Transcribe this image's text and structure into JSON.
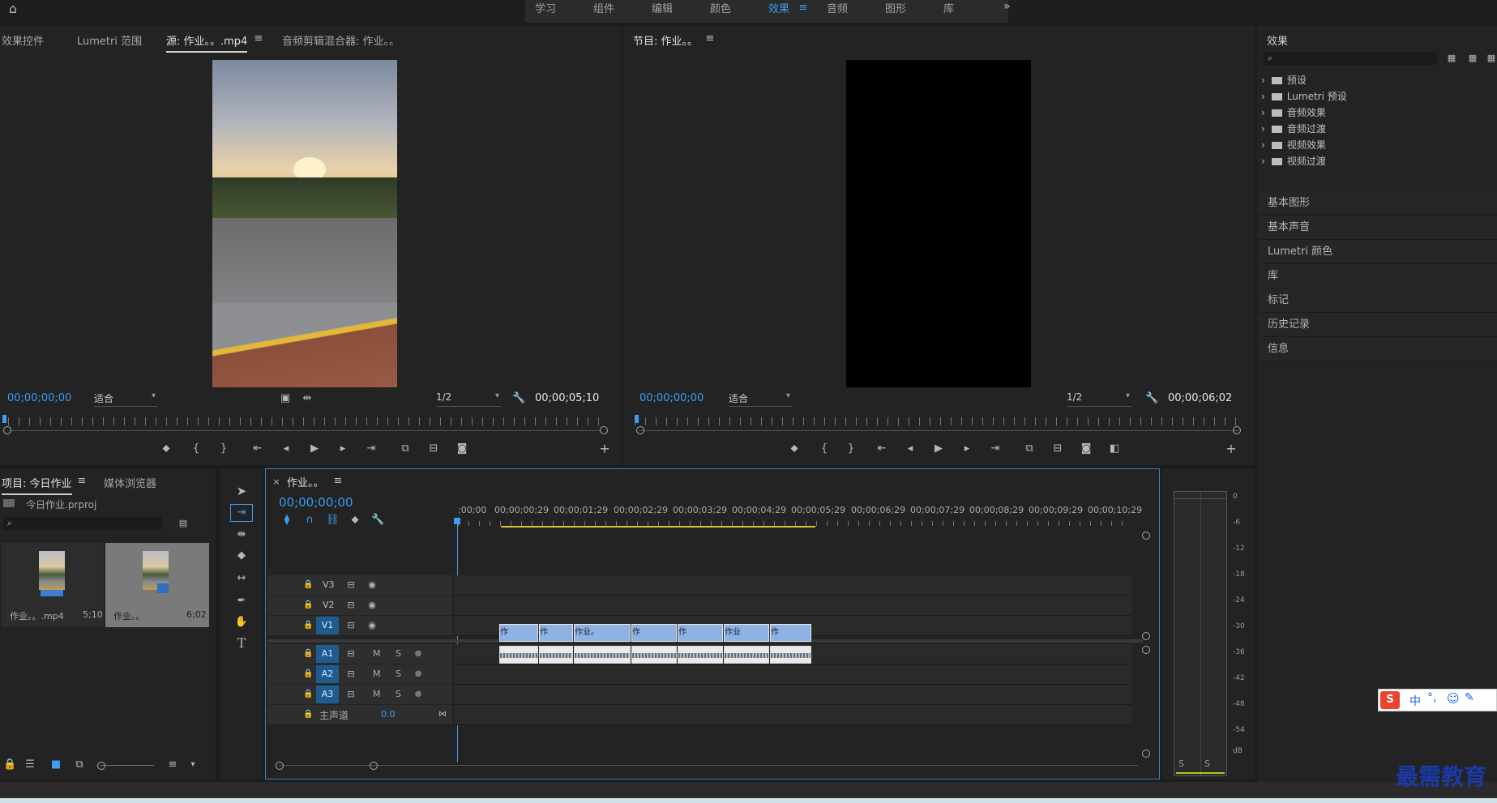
{
  "workspaces": {
    "items": [
      "学习",
      "组件",
      "编辑",
      "颜色",
      "效果",
      "音频",
      "图形",
      "库"
    ],
    "active": "效果",
    "overflow": "»"
  },
  "source_panel": {
    "tabs": [
      "效果控件",
      "Lumetri 范围",
      "源: 作业。。.mp4",
      "音频剪辑混合器: 作业。。"
    ],
    "active_tab": 2,
    "timecode_left": "00;00;00;00",
    "fit": "适合",
    "resolution": "1/2",
    "timecode_right": "00;00;05;10"
  },
  "program_panel": {
    "title": "节目: 作业。。",
    "timecode_left": "00;00;00;00",
    "fit": "适合",
    "resolution": "1/2",
    "timecode_right": "00;00;06;02"
  },
  "project_panel": {
    "tabs": [
      "项目: 今日作业",
      "媒体浏览器"
    ],
    "file": "今日作业.prproj",
    "items": [
      {
        "name": "作业。。.mp4",
        "duration": "5;10"
      },
      {
        "name": "作业。。",
        "duration": "6;02"
      }
    ]
  },
  "timeline": {
    "tab": "作业。。",
    "timecode": "00;00;00;00",
    "ruler": [
      ";00;00",
      "00;00;00;29",
      "00;00;01;29",
      "00;00;02;29",
      "00;00;03;29",
      "00;00;04;29",
      "00;00;05;29",
      "00;00;06;29",
      "00;00;07;29",
      "00;00;08;29",
      "00;00;09;29",
      "00;00;10;29"
    ],
    "video_tracks": [
      "V3",
      "V2",
      "V1"
    ],
    "audio_tracks": [
      "A1",
      "A2",
      "A3"
    ],
    "mute_label": "M",
    "solo_label": "S",
    "master": {
      "label": "主声道",
      "value": "0.0"
    },
    "clip_labels": [
      "作",
      "作",
      "作业。",
      "作",
      "作",
      "作业",
      "作"
    ]
  },
  "effects_panel": {
    "title": "效果",
    "folders": [
      "预设",
      "Lumetri 预设",
      "音频效果",
      "音频过渡",
      "视频效果",
      "视频过渡"
    ]
  },
  "right_panels": [
    "基本图形",
    "基本声音",
    "Lumetri 颜色",
    "库",
    "标记",
    "历史记录",
    "信息"
  ],
  "audio_meter": {
    "scale": [
      "0",
      "-6",
      "-12",
      "-18",
      "-24",
      "-30",
      "-36",
      "-42",
      "-48",
      "-54",
      "dB"
    ],
    "solo_buttons": [
      "S",
      "S"
    ]
  },
  "ime_bar": {
    "label": "中"
  },
  "watermark": "最需教育",
  "colors": {
    "accent": "#3d9cf5",
    "panel": "#232323",
    "track_button": "#1e5c90"
  }
}
